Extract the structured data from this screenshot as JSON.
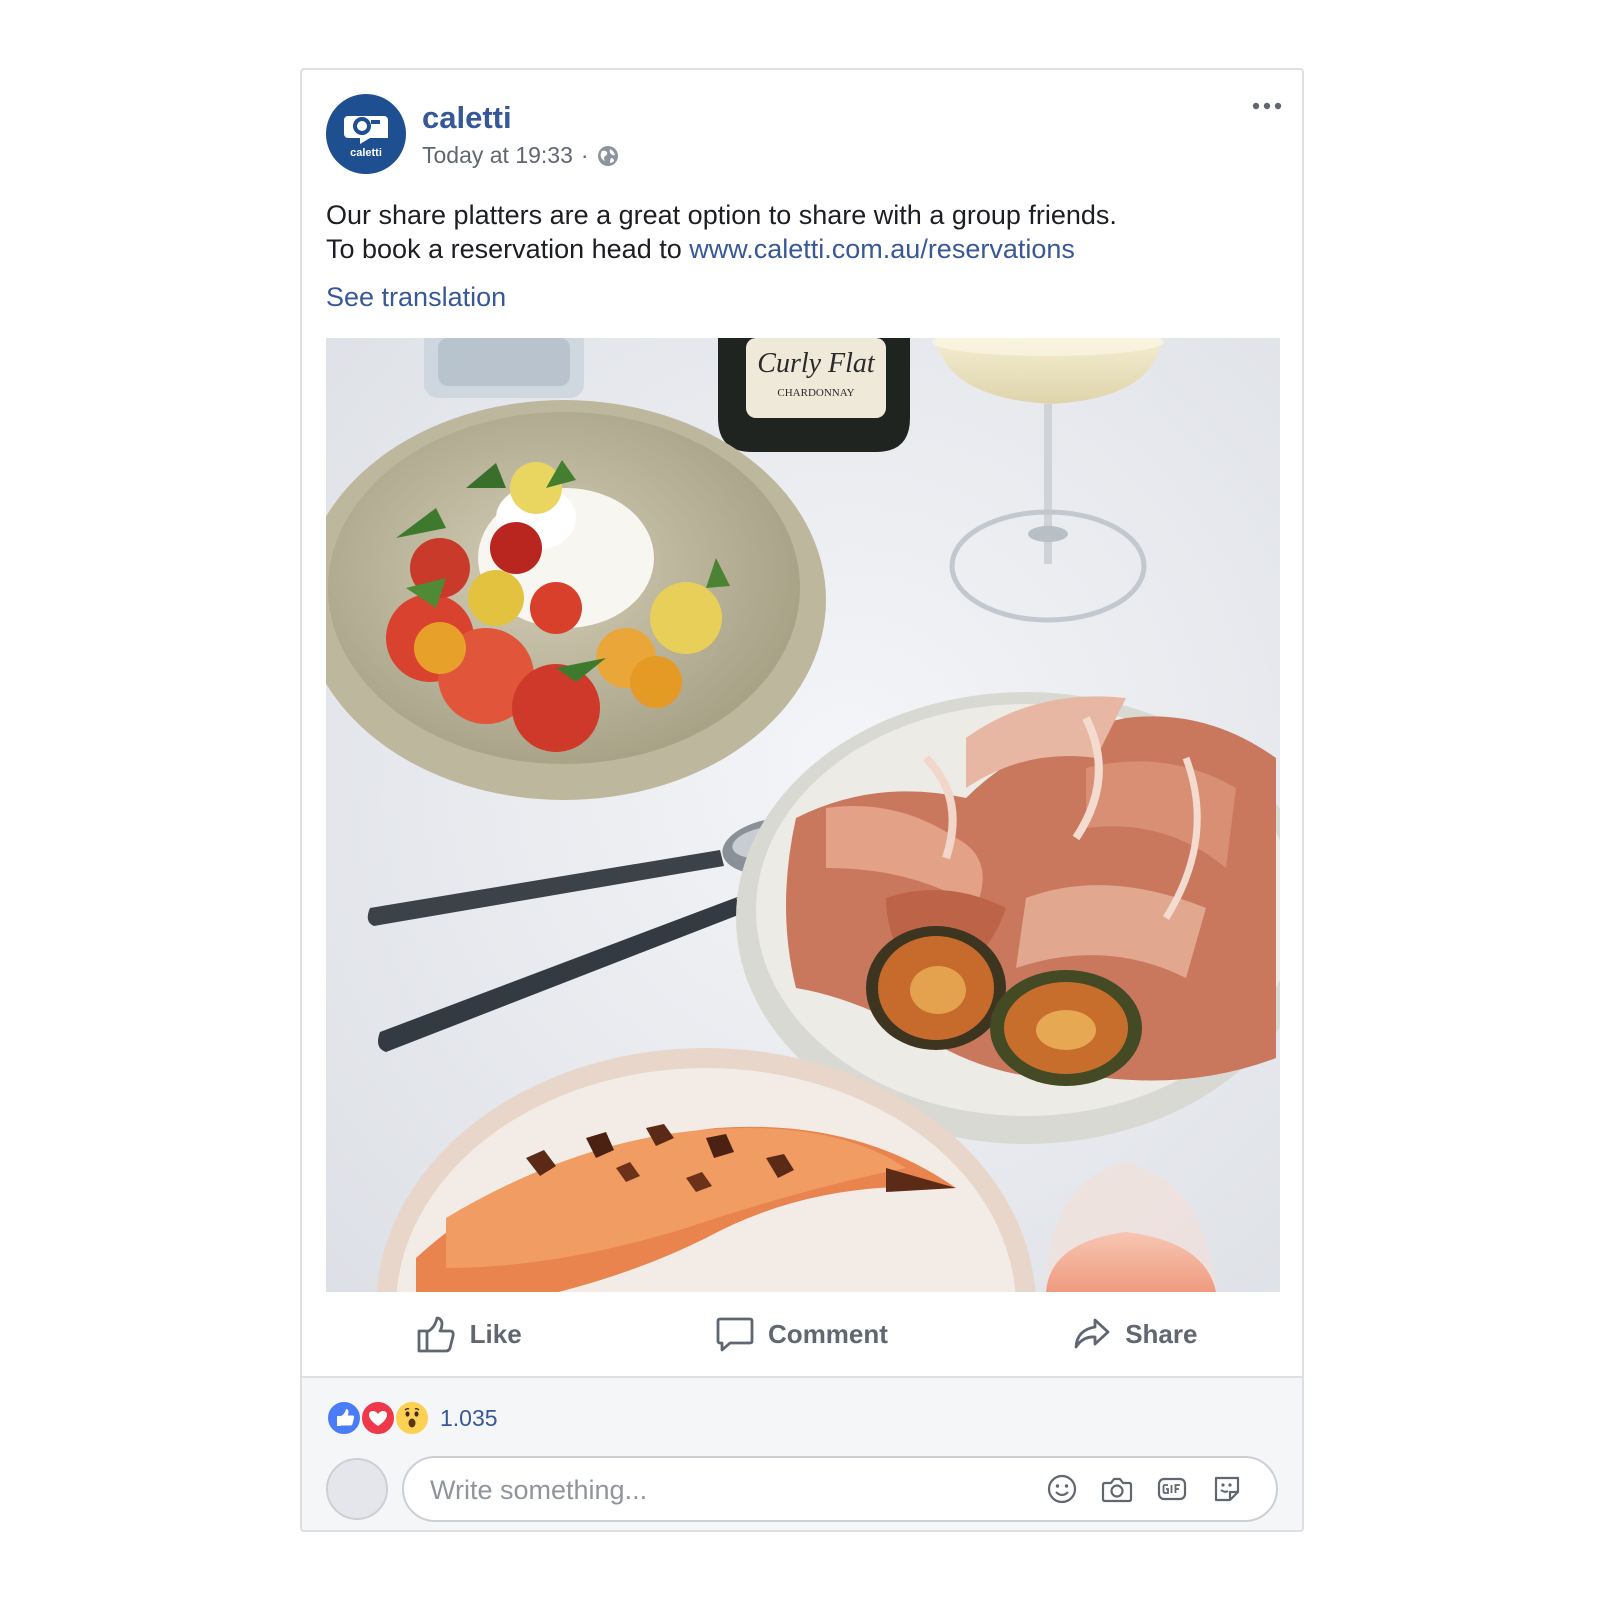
{
  "post": {
    "page_name": "caletti",
    "timestamp": "Today at 19:33",
    "separator": "·",
    "privacy_icon": "globe-icon",
    "text_line1": "Our share platters are a great option to share with a group friends.",
    "text_line2_prefix": "To book a reservation head to ",
    "link_text": "www.caletti.com.au/reservations",
    "see_translation": "See translation",
    "avatar_logo_text": "caletti",
    "wine_label_brand": "Curly Flat",
    "wine_label_variety": "CHARDONNAY"
  },
  "actions": {
    "like": "Like",
    "comment": "Comment",
    "share": "Share"
  },
  "reactions": {
    "icons": [
      "like-reaction-icon",
      "love-reaction-icon",
      "wow-reaction-icon"
    ],
    "count": "1.035"
  },
  "composer": {
    "placeholder": "Write something...",
    "icons": [
      "emoji-icon",
      "camera-icon",
      "gif-icon",
      "sticker-icon"
    ]
  },
  "colors": {
    "brand_blue": "#365899",
    "link_blue": "#385898",
    "avatar_blue": "#1d4f91",
    "like_blue": "#4a7cf6",
    "love_red": "#f0384b",
    "wow_yellow": "#fcd052"
  }
}
